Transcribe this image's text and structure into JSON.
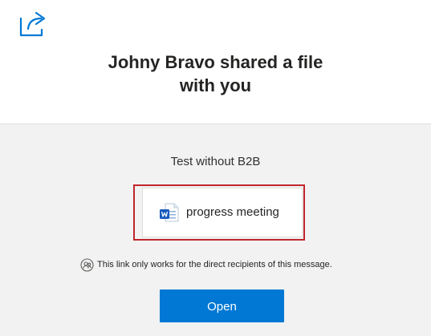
{
  "header": {
    "icon": "share-icon",
    "title_line1": "Johny Bravo shared a file",
    "title_line2": "with you"
  },
  "share": {
    "message": "Test without B2B",
    "file": {
      "icon": "word-document-icon",
      "name": "progress meeting"
    },
    "notice_icon": "people-icon",
    "notice": "This link only works for the direct recipients of this message.",
    "open_button_label": "Open"
  },
  "colors": {
    "accent": "#0078d4",
    "highlight_border": "#c0272d",
    "body_background": "#f2f2f2",
    "header_background": "#ffffff",
    "text": "#252423"
  }
}
